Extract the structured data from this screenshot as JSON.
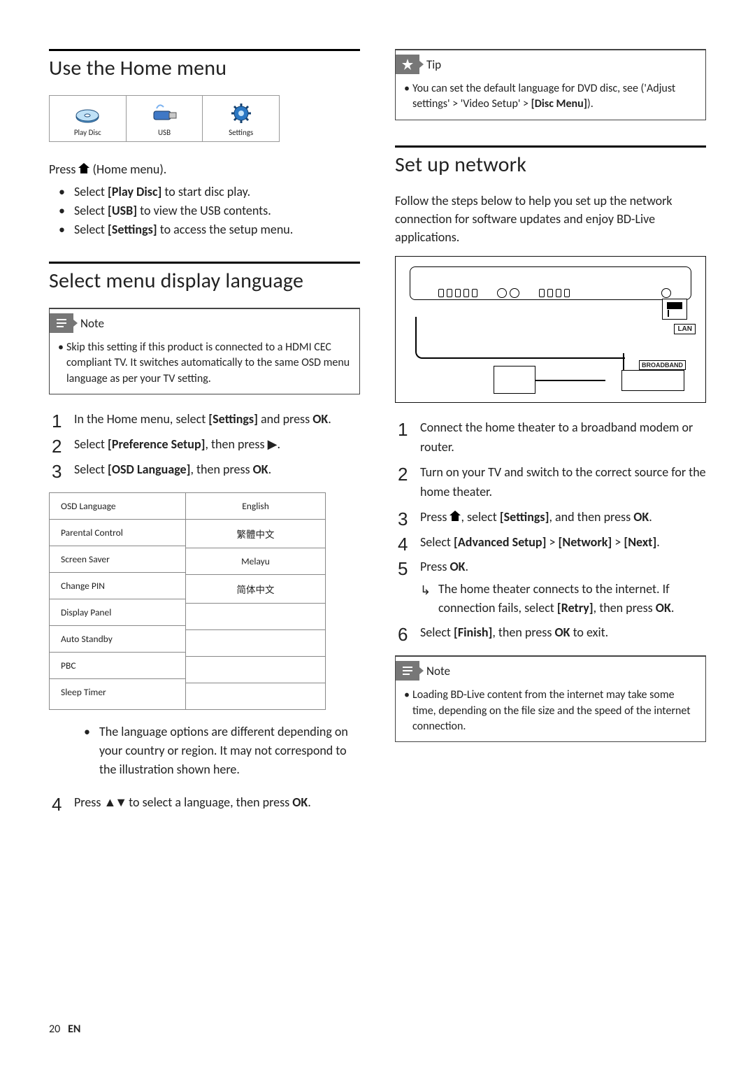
{
  "left": {
    "section_home": "Use the Home menu",
    "icons": {
      "play_disc": "Play Disc",
      "usb": "USB",
      "settings": "Settings"
    },
    "press_home_pre": "Press ",
    "press_home_post": " (Home menu).",
    "bullets": {
      "play_a": "Select ",
      "play_b": "[Play Disc]",
      "play_c": " to start disc play.",
      "usb_a": "Select ",
      "usb_b": "[USB]",
      "usb_c": " to view the USB contents.",
      "set_a": "Select ",
      "set_b": "[Settings]",
      "set_c": " to access the setup menu."
    },
    "section_lang": "Select menu display language",
    "note_label": "Note",
    "note_text": "Skip this setting if this product is connected to a HDMI CEC compliant TV. It switches automatically to the same OSD menu language as per your TV setting.",
    "steps": {
      "s1a": "In the Home menu, select ",
      "s1b": "[Settings]",
      "s1c": " and press ",
      "s1d": "OK",
      "s1e": ".",
      "s2a": "Select ",
      "s2b": "[Preference Setup]",
      "s2c": ", then press ",
      "s2d": "▶",
      "s2e": ".",
      "s3a": "Select ",
      "s3b": "[OSD Language]",
      "s3c": ", then press ",
      "s3d": "OK",
      "s3e": "."
    },
    "ui_left": [
      "OSD Language",
      "Parental Control",
      "Screen Saver",
      "Change PIN",
      "Display Panel",
      "Auto Standby",
      "PBC",
      "Sleep Timer"
    ],
    "ui_right": [
      "English",
      "繁體中文",
      "Melayu",
      "简体中文",
      " ",
      " ",
      " ",
      " "
    ],
    "sub_note": "The language options are different depending on your country or region. It may not correspond to the illustration shown here.",
    "s4a": "Press ",
    "s4b": "▲▼",
    "s4c": " to select a language, then press ",
    "s4d": "OK",
    "s4e": "."
  },
  "right": {
    "tip_label": "Tip",
    "tip_a": "You can set the default language for DVD disc, see ('Adjust settings' > 'Video Setup' > ",
    "tip_b": "[Disc Menu]",
    "tip_c": ").",
    "section_net": "Set up network",
    "intro": "Follow the steps below to help you set up the network connection for software updates and enjoy BD-Live applications.",
    "lan": "LAN",
    "broadband": "BROADBAND",
    "steps": {
      "n1": "Connect the home theater to a broadband modem or router.",
      "n2": "Turn on your TV and switch to the correct source for the home theater.",
      "n3a": "Press ",
      "n3b": ", select ",
      "n3c": "[Settings]",
      "n3d": ", and then press ",
      "n3e": "OK",
      "n3f": ".",
      "n4a": "Select ",
      "n4b": "[Advanced Setup]",
      "n4c": " > ",
      "n4d": "[Network]",
      "n4e": " > ",
      "n4f": "[Next]",
      "n4g": ".",
      "n5a": "Press ",
      "n5b": "OK",
      "n5c": ".",
      "n5sub_a": "The home theater connects to the internet. If connection fails, select ",
      "n5sub_b": "[Retry]",
      "n5sub_c": ", then press ",
      "n5sub_d": "OK",
      "n5sub_e": ".",
      "n6a": "Select ",
      "n6b": "[Finish]",
      "n6c": ", then press ",
      "n6d": "OK",
      "n6e": " to exit."
    },
    "note_label": "Note",
    "note_text": "Loading BD-Live content from the internet may take some time, depending on the file size and the speed of the internet connection."
  },
  "footer": {
    "page": "20",
    "lang": "EN"
  }
}
